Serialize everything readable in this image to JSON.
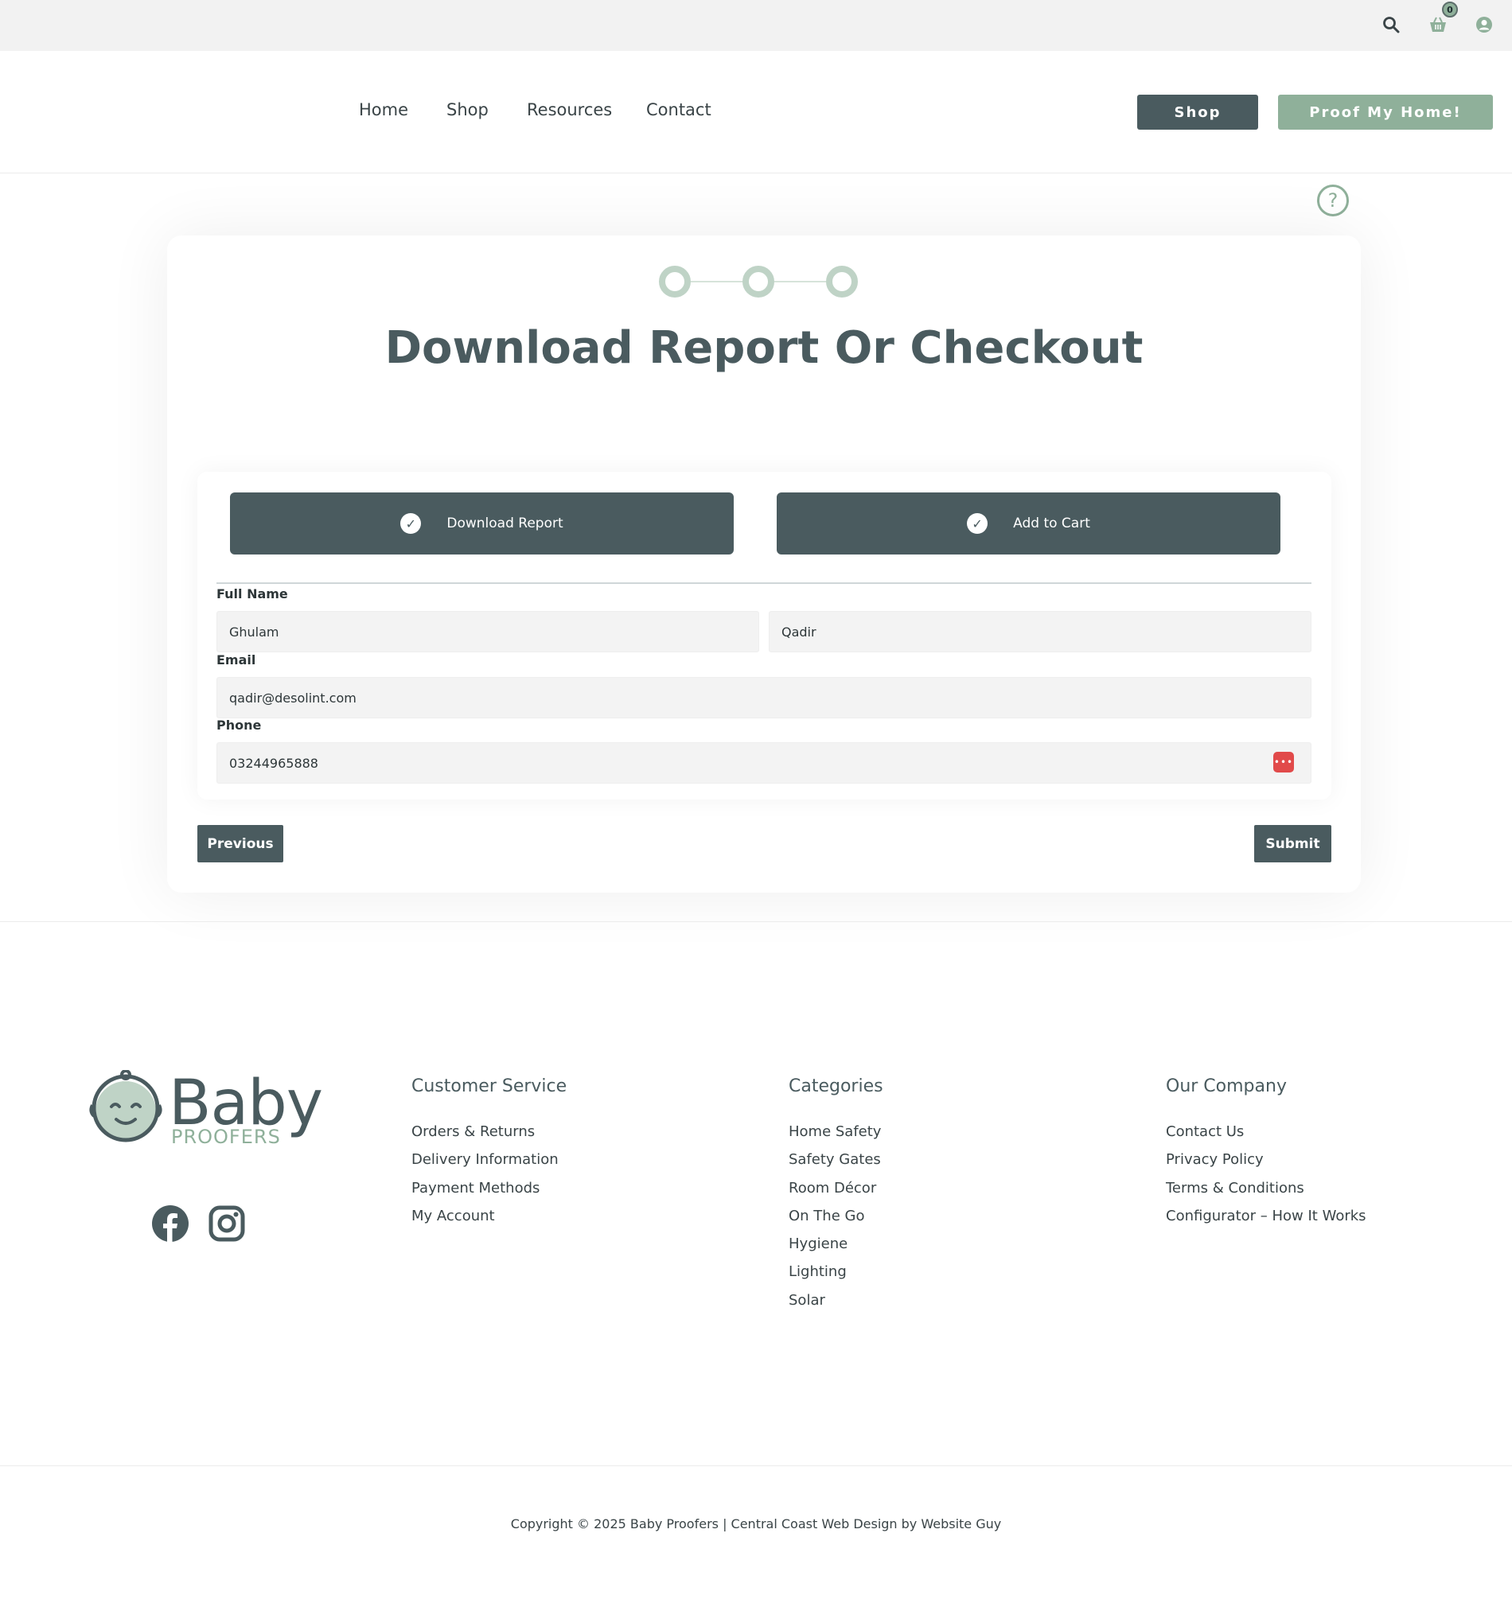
{
  "topbar": {
    "icons": [
      "search-icon",
      "cart-icon",
      "user-icon"
    ],
    "cart_count": "0"
  },
  "header": {
    "nav": [
      "Home",
      "Shop",
      "Resources",
      "Contact"
    ],
    "shop_button": "Shop",
    "proof_button": "Proof My Home!"
  },
  "help_icon": "?",
  "form": {
    "title": "Download Report Or Checkout",
    "steps": 3,
    "options": [
      {
        "label": "Download Report",
        "selected": true
      },
      {
        "label": "Add to Cart",
        "selected": true
      }
    ],
    "full_name_label": "Full Name",
    "first_name": "Ghulam",
    "last_name": "Qadir",
    "email_label": "Email",
    "email": "qadir@desolint.com",
    "phone_label": "Phone",
    "phone": "03244965888",
    "previous_button": "Previous",
    "submit_button": "Submit"
  },
  "footer": {
    "logo_word": "Baby",
    "logo_sub": "PROOFERS",
    "social": [
      "facebook-icon",
      "instagram-icon"
    ],
    "columns": [
      {
        "title": "Customer Service",
        "items": [
          "Orders & Returns",
          "Delivery Information",
          "Payment Methods",
          "My Account"
        ]
      },
      {
        "title": "Categories",
        "items": [
          "Home Safety",
          "Safety Gates",
          "Room Décor",
          "On The Go",
          "Hygiene",
          "Lighting",
          "Solar"
        ]
      },
      {
        "title": "Our Company",
        "items": [
          "Contact Us",
          "Privacy Policy",
          "Terms & Conditions",
          "Configurator – How It Works"
        ]
      }
    ],
    "copyright": "Copyright © 2025 Baby Proofers | Central Coast Web Design by Website Guy"
  },
  "colors": {
    "primary": "#4a5b5f",
    "accent": "#8fb09a",
    "step": "#bfd3c6",
    "alert": "#e14a4a"
  }
}
